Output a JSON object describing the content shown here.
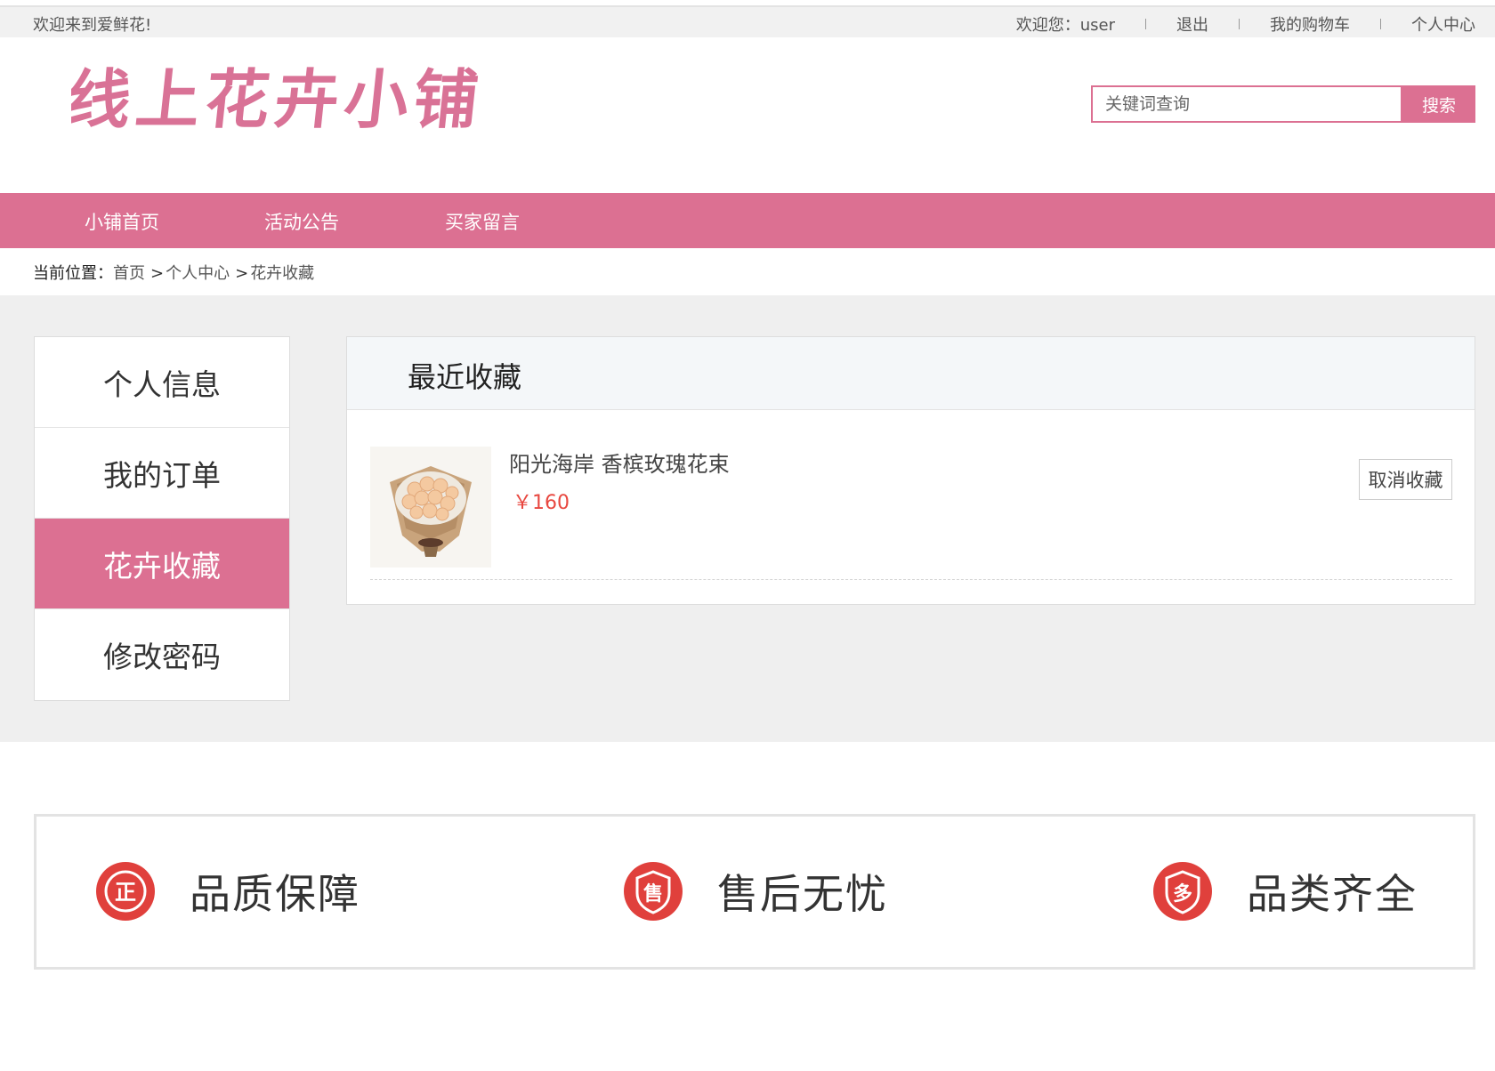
{
  "topbar": {
    "welcome": "欢迎来到爱鲜花!",
    "greeting": "欢迎您：user",
    "logout": "退出",
    "cart": "我的购物车",
    "profile": "个人中心"
  },
  "header": {
    "logo_text": "线上花卉小铺",
    "search_placeholder": "关键词查询",
    "search_button": "搜索"
  },
  "nav": {
    "items": [
      "小铺首页",
      "活动公告",
      "买家留言"
    ]
  },
  "breadcrumb": {
    "label": "当前位置：",
    "home": "首页",
    "center": "个人中心",
    "current": "花卉收藏"
  },
  "sidebar": {
    "items": [
      {
        "label": "个人信息"
      },
      {
        "label": "我的订单"
      },
      {
        "label": "花卉收藏",
        "active": true
      },
      {
        "label": "修改密码"
      }
    ]
  },
  "favorites": {
    "title": "最近收藏",
    "items": [
      {
        "name": "阳光海岸 香槟玫瑰花束",
        "price": "￥160",
        "cancel": "取消收藏"
      }
    ]
  },
  "guarantees": [
    {
      "icon": "zheng-badge-icon",
      "glyph": "正",
      "label": "品质保障"
    },
    {
      "icon": "shou-badge-icon",
      "glyph": "售",
      "label": "售后无忧"
    },
    {
      "icon": "duo-badge-icon",
      "glyph": "多",
      "label": "品类齐全"
    }
  ],
  "colors": {
    "accent": "#dc7092",
    "price": "#e8473f",
    "badge": "#e0403c"
  }
}
